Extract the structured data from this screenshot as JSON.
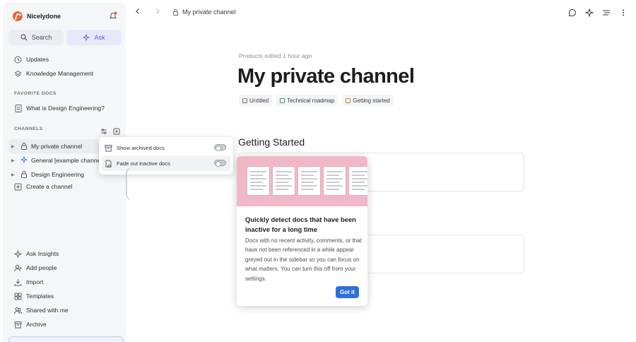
{
  "workspace": {
    "name": "Nicelydone"
  },
  "top_buttons": {
    "search": "Search",
    "ask": "Ask"
  },
  "nav": {
    "updates": "Updates",
    "knowledge": "Knowledge Management"
  },
  "favorites": {
    "label": "FAVORITE DOCS",
    "items": [
      "What is Design Engineering?"
    ]
  },
  "channels": {
    "label": "CHANNELS",
    "items": [
      "My private channel",
      "General [example channel]",
      "Design Engineering"
    ],
    "create": "Create a channel"
  },
  "bottom_nav": [
    "Ask Insights",
    "Add people",
    "Import",
    "Templates",
    "Shared with me",
    "Archive"
  ],
  "menu": {
    "show_archived": "Show archived docs",
    "fade_inactive": "Fade out inactive docs",
    "show_archived_on": false,
    "fade_inactive_on": false
  },
  "header": {
    "crumb": "My private channel"
  },
  "doc": {
    "meta": "Products edited 1 hour ago",
    "title": "My private channel",
    "chips": [
      "Untitled",
      "Technical roadmap",
      "Getting started"
    ],
    "section": "Getting Started"
  },
  "tour": {
    "heading": "Quickly detect docs that have been inactive for a long time",
    "body": "Docs with no recent activity, comments, or that have not been referenced in a while appear greyed out in the sidebar so you can focus on what matters. You can turn this off from your settings.",
    "button": "Got it"
  }
}
